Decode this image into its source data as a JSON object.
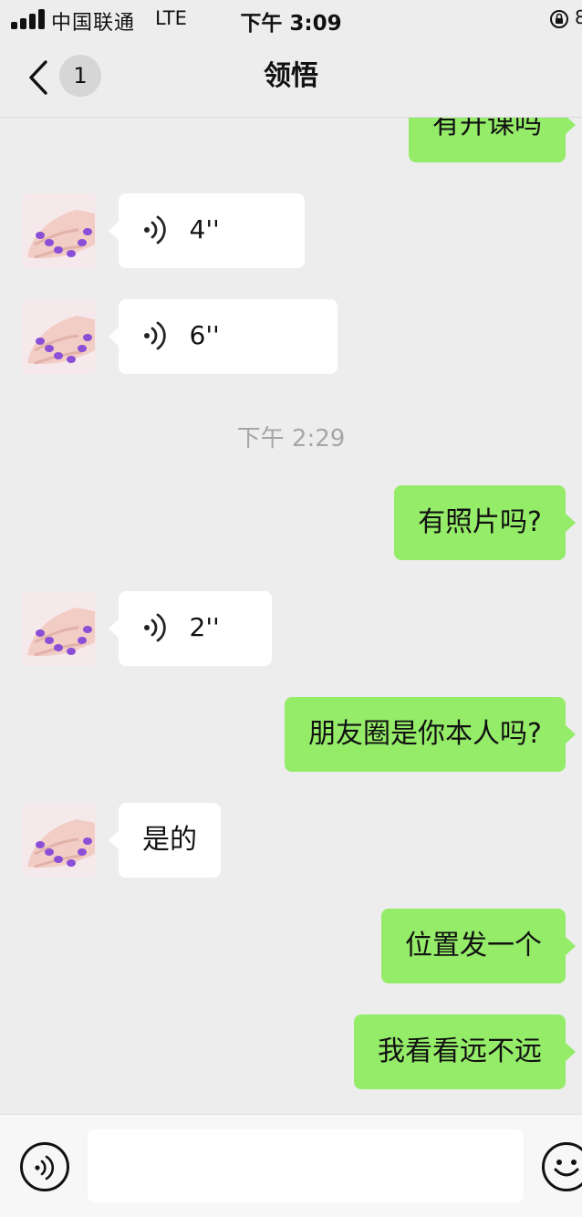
{
  "status_bar": {
    "carrier": "中国联通",
    "network": "LTE",
    "time": "下午 3:09",
    "battery_partial": "8"
  },
  "nav": {
    "back_icon": "chevron-left-icon",
    "unread_count": "1",
    "title": "领悟"
  },
  "messages": [
    {
      "side": "out",
      "type": "text",
      "text": "有开课吗"
    },
    {
      "side": "in",
      "type": "voice",
      "duration": "4''",
      "avatar": "purple-nails-photo"
    },
    {
      "side": "in",
      "type": "voice",
      "duration": "6''",
      "avatar": "purple-nails-photo"
    },
    {
      "side": "system",
      "type": "timestamp",
      "text": "下午 2:29"
    },
    {
      "side": "out",
      "type": "text",
      "text": "有照片吗?"
    },
    {
      "side": "in",
      "type": "voice",
      "duration": "2''",
      "avatar": "purple-nails-photo"
    },
    {
      "side": "out",
      "type": "text",
      "text": "朋友圈是你本人吗?"
    },
    {
      "side": "in",
      "type": "text",
      "text": "是的",
      "avatar": "purple-nails-photo"
    },
    {
      "side": "out",
      "type": "text",
      "text": "位置发一个"
    },
    {
      "side": "out",
      "type": "text",
      "text": "我看看远不远"
    }
  ],
  "input_bar": {
    "voice_toggle_icon": "voice-wave-icon",
    "text_value": "",
    "emoji_icon": "smiley-icon"
  },
  "colors": {
    "background": "#ededed",
    "outgoing_bubble": "#95ec69",
    "incoming_bubble": "#ffffff",
    "timestamp_text": "#a6a6a6"
  }
}
